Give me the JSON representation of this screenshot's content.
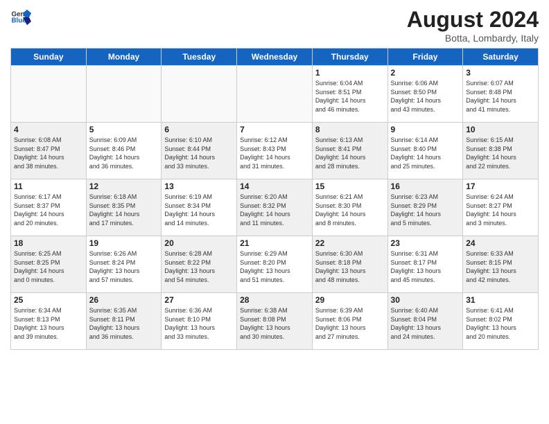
{
  "header": {
    "logo_general": "General",
    "logo_blue": "Blue",
    "title": "August 2024",
    "subtitle": "Botta, Lombardy, Italy"
  },
  "days_of_week": [
    "Sunday",
    "Monday",
    "Tuesday",
    "Wednesday",
    "Thursday",
    "Friday",
    "Saturday"
  ],
  "weeks": [
    [
      {
        "num": "",
        "info": "",
        "empty": true
      },
      {
        "num": "",
        "info": "",
        "empty": true
      },
      {
        "num": "",
        "info": "",
        "empty": true
      },
      {
        "num": "",
        "info": "",
        "empty": true
      },
      {
        "num": "1",
        "info": "Sunrise: 6:04 AM\nSunset: 8:51 PM\nDaylight: 14 hours\nand 46 minutes."
      },
      {
        "num": "2",
        "info": "Sunrise: 6:06 AM\nSunset: 8:50 PM\nDaylight: 14 hours\nand 43 minutes."
      },
      {
        "num": "3",
        "info": "Sunrise: 6:07 AM\nSunset: 8:48 PM\nDaylight: 14 hours\nand 41 minutes."
      }
    ],
    [
      {
        "num": "4",
        "info": "Sunrise: 6:08 AM\nSunset: 8:47 PM\nDaylight: 14 hours\nand 38 minutes.",
        "shaded": true
      },
      {
        "num": "5",
        "info": "Sunrise: 6:09 AM\nSunset: 8:46 PM\nDaylight: 14 hours\nand 36 minutes."
      },
      {
        "num": "6",
        "info": "Sunrise: 6:10 AM\nSunset: 8:44 PM\nDaylight: 14 hours\nand 33 minutes.",
        "shaded": true
      },
      {
        "num": "7",
        "info": "Sunrise: 6:12 AM\nSunset: 8:43 PM\nDaylight: 14 hours\nand 31 minutes."
      },
      {
        "num": "8",
        "info": "Sunrise: 6:13 AM\nSunset: 8:41 PM\nDaylight: 14 hours\nand 28 minutes.",
        "shaded": true
      },
      {
        "num": "9",
        "info": "Sunrise: 6:14 AM\nSunset: 8:40 PM\nDaylight: 14 hours\nand 25 minutes."
      },
      {
        "num": "10",
        "info": "Sunrise: 6:15 AM\nSunset: 8:38 PM\nDaylight: 14 hours\nand 22 minutes.",
        "shaded": true
      }
    ],
    [
      {
        "num": "11",
        "info": "Sunrise: 6:17 AM\nSunset: 8:37 PM\nDaylight: 14 hours\nand 20 minutes."
      },
      {
        "num": "12",
        "info": "Sunrise: 6:18 AM\nSunset: 8:35 PM\nDaylight: 14 hours\nand 17 minutes.",
        "shaded": true
      },
      {
        "num": "13",
        "info": "Sunrise: 6:19 AM\nSunset: 8:34 PM\nDaylight: 14 hours\nand 14 minutes."
      },
      {
        "num": "14",
        "info": "Sunrise: 6:20 AM\nSunset: 8:32 PM\nDaylight: 14 hours\nand 11 minutes.",
        "shaded": true
      },
      {
        "num": "15",
        "info": "Sunrise: 6:21 AM\nSunset: 8:30 PM\nDaylight: 14 hours\nand 8 minutes."
      },
      {
        "num": "16",
        "info": "Sunrise: 6:23 AM\nSunset: 8:29 PM\nDaylight: 14 hours\nand 5 minutes.",
        "shaded": true
      },
      {
        "num": "17",
        "info": "Sunrise: 6:24 AM\nSunset: 8:27 PM\nDaylight: 14 hours\nand 3 minutes."
      }
    ],
    [
      {
        "num": "18",
        "info": "Sunrise: 6:25 AM\nSunset: 8:25 PM\nDaylight: 14 hours\nand 0 minutes.",
        "shaded": true
      },
      {
        "num": "19",
        "info": "Sunrise: 6:26 AM\nSunset: 8:24 PM\nDaylight: 13 hours\nand 57 minutes."
      },
      {
        "num": "20",
        "info": "Sunrise: 6:28 AM\nSunset: 8:22 PM\nDaylight: 13 hours\nand 54 minutes.",
        "shaded": true
      },
      {
        "num": "21",
        "info": "Sunrise: 6:29 AM\nSunset: 8:20 PM\nDaylight: 13 hours\nand 51 minutes."
      },
      {
        "num": "22",
        "info": "Sunrise: 6:30 AM\nSunset: 8:18 PM\nDaylight: 13 hours\nand 48 minutes.",
        "shaded": true
      },
      {
        "num": "23",
        "info": "Sunrise: 6:31 AM\nSunset: 8:17 PM\nDaylight: 13 hours\nand 45 minutes."
      },
      {
        "num": "24",
        "info": "Sunrise: 6:33 AM\nSunset: 8:15 PM\nDaylight: 13 hours\nand 42 minutes.",
        "shaded": true
      }
    ],
    [
      {
        "num": "25",
        "info": "Sunrise: 6:34 AM\nSunset: 8:13 PM\nDaylight: 13 hours\nand 39 minutes."
      },
      {
        "num": "26",
        "info": "Sunrise: 6:35 AM\nSunset: 8:11 PM\nDaylight: 13 hours\nand 36 minutes.",
        "shaded": true
      },
      {
        "num": "27",
        "info": "Sunrise: 6:36 AM\nSunset: 8:10 PM\nDaylight: 13 hours\nand 33 minutes."
      },
      {
        "num": "28",
        "info": "Sunrise: 6:38 AM\nSunset: 8:08 PM\nDaylight: 13 hours\nand 30 minutes.",
        "shaded": true
      },
      {
        "num": "29",
        "info": "Sunrise: 6:39 AM\nSunset: 8:06 PM\nDaylight: 13 hours\nand 27 minutes."
      },
      {
        "num": "30",
        "info": "Sunrise: 6:40 AM\nSunset: 8:04 PM\nDaylight: 13 hours\nand 24 minutes.",
        "shaded": true
      },
      {
        "num": "31",
        "info": "Sunrise: 6:41 AM\nSunset: 8:02 PM\nDaylight: 13 hours\nand 20 minutes."
      }
    ]
  ]
}
